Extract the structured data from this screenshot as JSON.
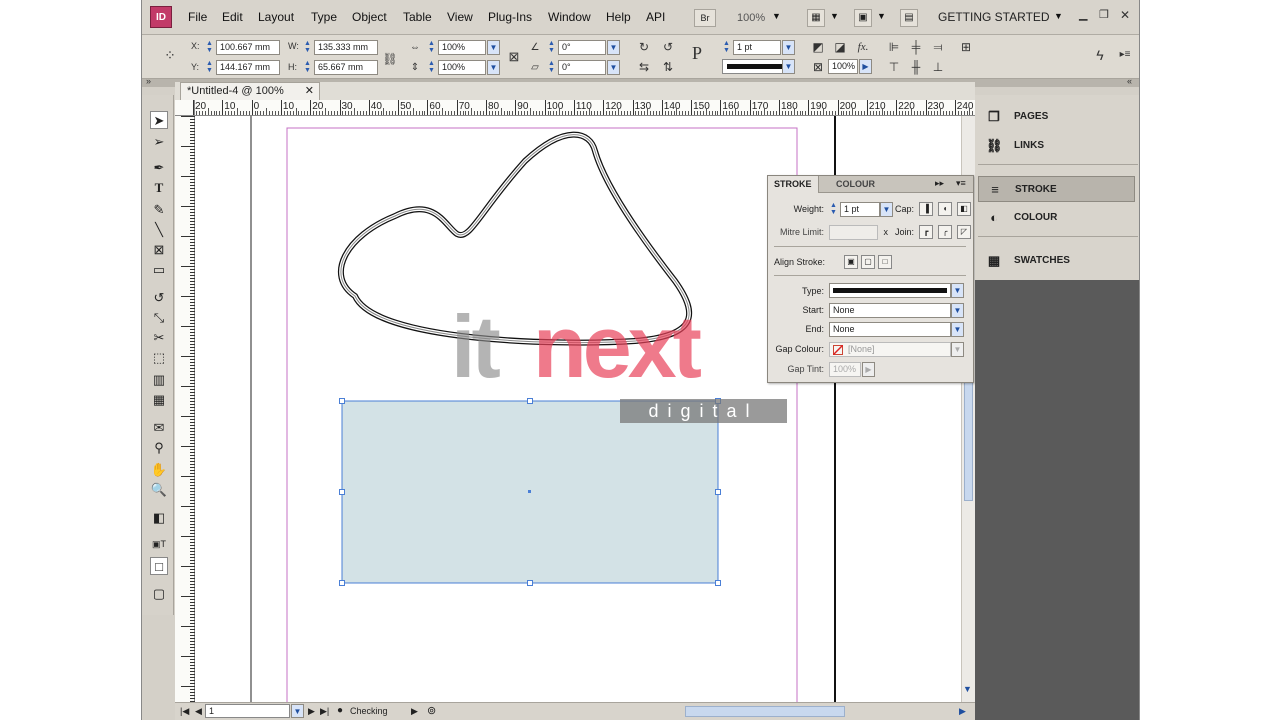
{
  "menubar": {
    "app_icon": "ID",
    "items": [
      "File",
      "Edit",
      "Layout",
      "Type",
      "Object",
      "Table",
      "View",
      "Plug-Ins",
      "Window",
      "Help",
      "API"
    ],
    "bridge_label": "Br",
    "zoom": "100%",
    "workspace": "GETTING STARTED"
  },
  "control": {
    "x_label": "X:",
    "x_value": "100.667 mm",
    "y_label": "Y:",
    "y_value": "144.167 mm",
    "w_label": "W:",
    "w_value": "135.333 mm",
    "h_label": "H:",
    "h_value": "65.667 mm",
    "scale_x": "100%",
    "scale_y": "100%",
    "rotate": "0°",
    "shear": "0°",
    "stroke_weight": "1 pt",
    "opacity": "100%"
  },
  "document": {
    "tab_title": "*Untitled-4 @ 100%",
    "close": "✕",
    "ruler_ticks": [
      "20",
      "10",
      "0",
      "10",
      "20",
      "30",
      "40",
      "50",
      "60",
      "70",
      "80",
      "90",
      "100",
      "110",
      "120",
      "130",
      "140",
      "150",
      "160",
      "170",
      "180",
      "190",
      "200",
      "210",
      "220",
      "230",
      "240"
    ],
    "page_number": "1",
    "preflight": "Checking"
  },
  "stroke_panel": {
    "tab_stroke": "STROKE",
    "tab_colour": "COLOUR",
    "weight_label": "Weight:",
    "weight_value": "1 pt",
    "cap_label": "Cap:",
    "miter_label": "Mitre Limit:",
    "miter_x": "x",
    "join_label": "Join:",
    "align_label": "Align Stroke:",
    "type_label": "Type:",
    "start_label": "Start:",
    "start_value": "None",
    "end_label": "End:",
    "end_value": "None",
    "gap_colour_label": "Gap Colour:",
    "gap_colour_value": "[None]",
    "gap_tint_label": "Gap Tint:",
    "gap_tint_value": "100%"
  },
  "right_panels": {
    "items": [
      {
        "label": "PAGES",
        "icon": "pages-icon"
      },
      {
        "label": "LINKS",
        "icon": "links-icon"
      },
      {
        "label": "STROKE",
        "icon": "stroke-icon"
      },
      {
        "label": "COLOUR",
        "icon": "colour-icon"
      },
      {
        "label": "SWATCHES",
        "icon": "swatches-icon"
      }
    ]
  },
  "watermark": {
    "brand_it": "it",
    "brand_next": "next",
    "brand_sub": "digital"
  },
  "colors": {
    "frame_fill": "#d3e2e6",
    "selection": "#4a7fd6",
    "margin_guide": "#c470c4",
    "watermark_red": "#e8425a"
  }
}
